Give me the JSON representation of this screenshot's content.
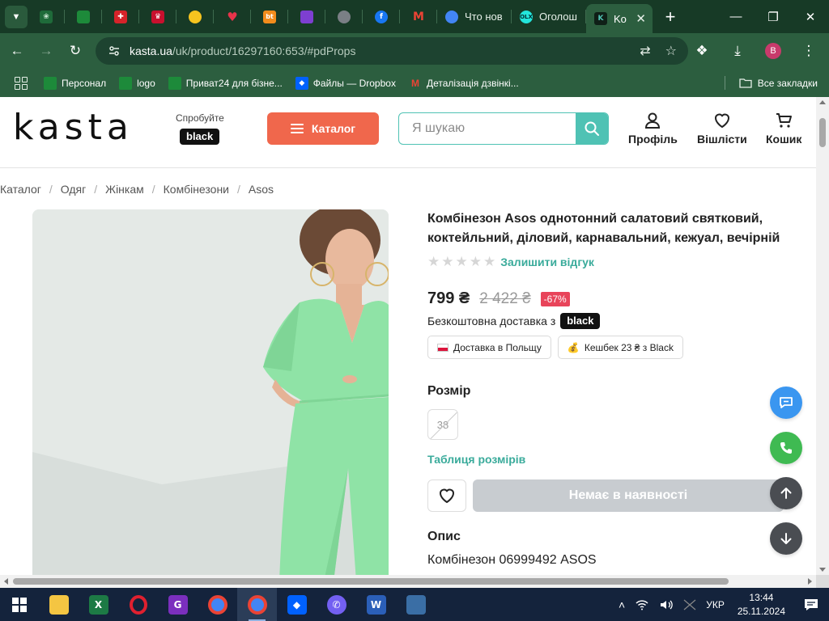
{
  "browser": {
    "tabs": [
      {
        "label": "Что нов",
        "icon": "chrome-icon"
      },
      {
        "label": "Оголош",
        "icon": "olx-icon"
      },
      {
        "label": "Ko",
        "icon": "kasta-icon",
        "active": true
      }
    ],
    "new_tab": "+",
    "url": {
      "host": "kasta.ua",
      "path": "/uk/product/16297160:653/#pdProps"
    },
    "profile_initial": "B",
    "bookmarks": [
      {
        "label": "Персонал",
        "icon": "green-square-icon"
      },
      {
        "label": "logo",
        "icon": "green-square-icon"
      },
      {
        "label": "Приват24 для бізне...",
        "icon": "privat-icon"
      },
      {
        "label": "Файлы — Dropbox",
        "icon": "dropbox-icon"
      },
      {
        "label": "Деталізація дзвінкі...",
        "icon": "gmail-icon"
      }
    ],
    "all_bookmarks": "Все закладки"
  },
  "site": {
    "logo": "kasta",
    "try_label": "Спробуйте",
    "black_label": "black",
    "catalog_label": "Каталог",
    "search_placeholder": "Я шукаю",
    "profile_label": "Профіль",
    "wishlist_label": "Вішлісти",
    "cart_label": "Кошик"
  },
  "breadcrumb": [
    "Каталог",
    "Одяг",
    "Жінкам",
    "Комбінезони",
    "Asos"
  ],
  "product": {
    "title": "Комбінезон Asos однотонний салатовий святковий, коктейльний, діловий, карнавальний, кежуал, вечірній",
    "review_link": "Залишити відгук",
    "rating": 0,
    "price": "799 ₴",
    "old_price": "2 422 ₴",
    "discount": "-67%",
    "free_delivery": "Безкоштовна доставка з",
    "delivery_black": "black",
    "chips": [
      "Доставка в Польщу",
      "Кешбек 23 ₴ з Black"
    ],
    "size_label": "Розмір",
    "sizes": [
      "38"
    ],
    "size_table": "Таблиця розмірів",
    "out_of_stock": "Немає в наявності",
    "description_label": "Опис",
    "description_text": "Комбінезон 06999492 ASOS"
  },
  "taskbar": {
    "language": "УКР",
    "time": "13:44",
    "date": "25.11.2024"
  },
  "colors": {
    "browser_dark": "#173a26",
    "browser_toolbar": "#2c5e3f",
    "accent_teal": "#4fc2b4",
    "catalog_orange": "#f0674c",
    "discount_red": "#e8445a",
    "product_green": "#8fe3a6"
  }
}
